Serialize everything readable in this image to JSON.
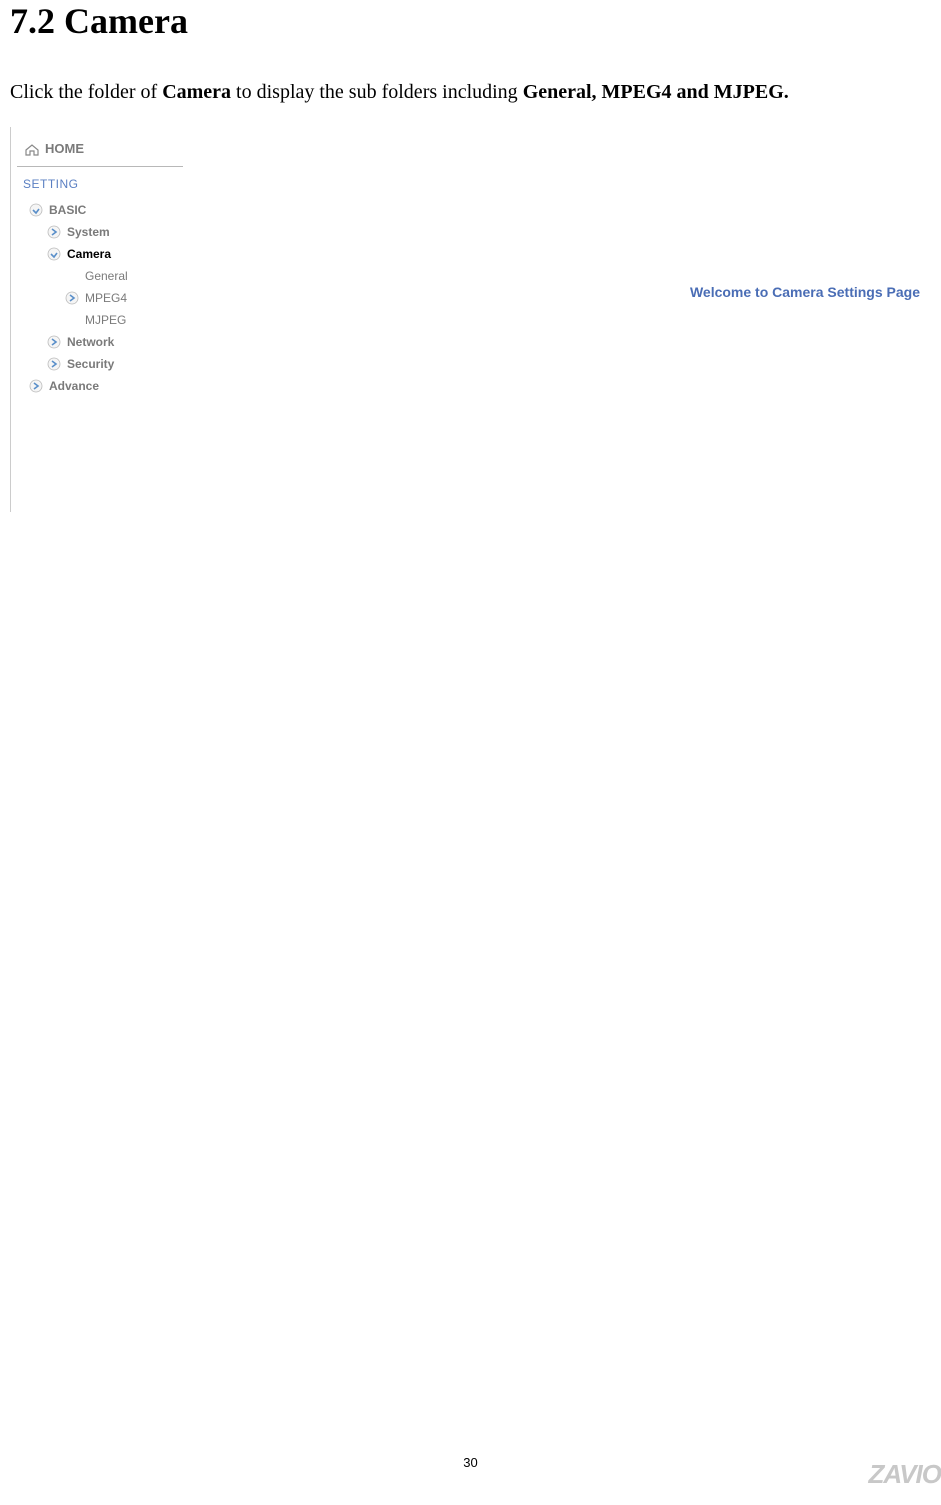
{
  "heading": "7.2 Camera",
  "description": {
    "part1": "Click the folder of ",
    "bold1": "Camera",
    "part2": " to display the sub folders including ",
    "bold2": "General, MPEG4 and MJPEG."
  },
  "sidebar": {
    "home": "HOME",
    "setting": "SETTING",
    "tree": {
      "basic": "BASIC",
      "system": "System",
      "camera": "Camera",
      "general": "General",
      "mpeg4": "MPEG4",
      "mjpeg": "MJPEG",
      "network": "Network",
      "security": "Security",
      "advance": "Advance"
    }
  },
  "main": {
    "welcome": "Welcome to Camera Settings Page"
  },
  "pageNumber": "30",
  "brand": "ZAVIO"
}
